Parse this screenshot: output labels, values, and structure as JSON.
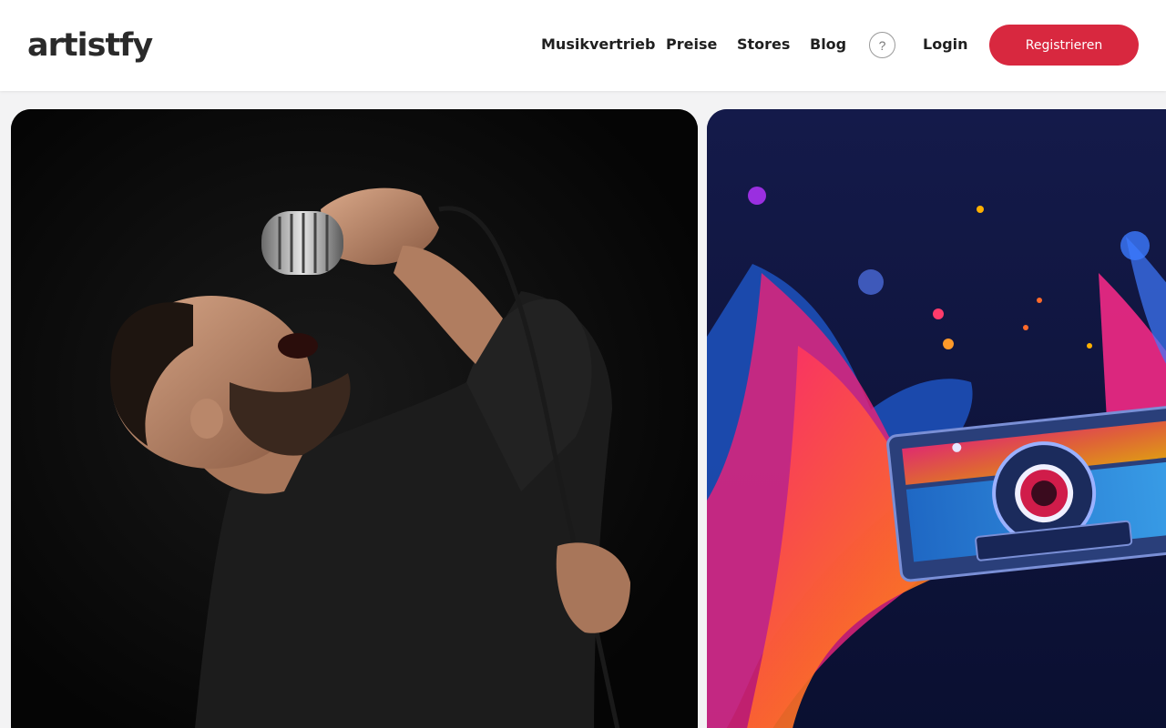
{
  "brand": {
    "logo_text": "artistfy"
  },
  "nav": {
    "items": [
      {
        "label": "Musikvertrieb"
      },
      {
        "label": "Preise"
      },
      {
        "label": "Stores"
      },
      {
        "label": "Blog"
      }
    ],
    "help_label": "?",
    "login_label": "Login",
    "register_label": "Registrieren"
  },
  "colors": {
    "accent": "#d8283f",
    "header_bg": "#ffffff",
    "page_bg": "#f3f3f4",
    "text": "#1f1f1f"
  },
  "hero_cards": [
    {
      "subject": "singer-with-vintage-microphone-photo"
    },
    {
      "subject": "cassette-tape-with-paint-splash-artwork"
    }
  ]
}
